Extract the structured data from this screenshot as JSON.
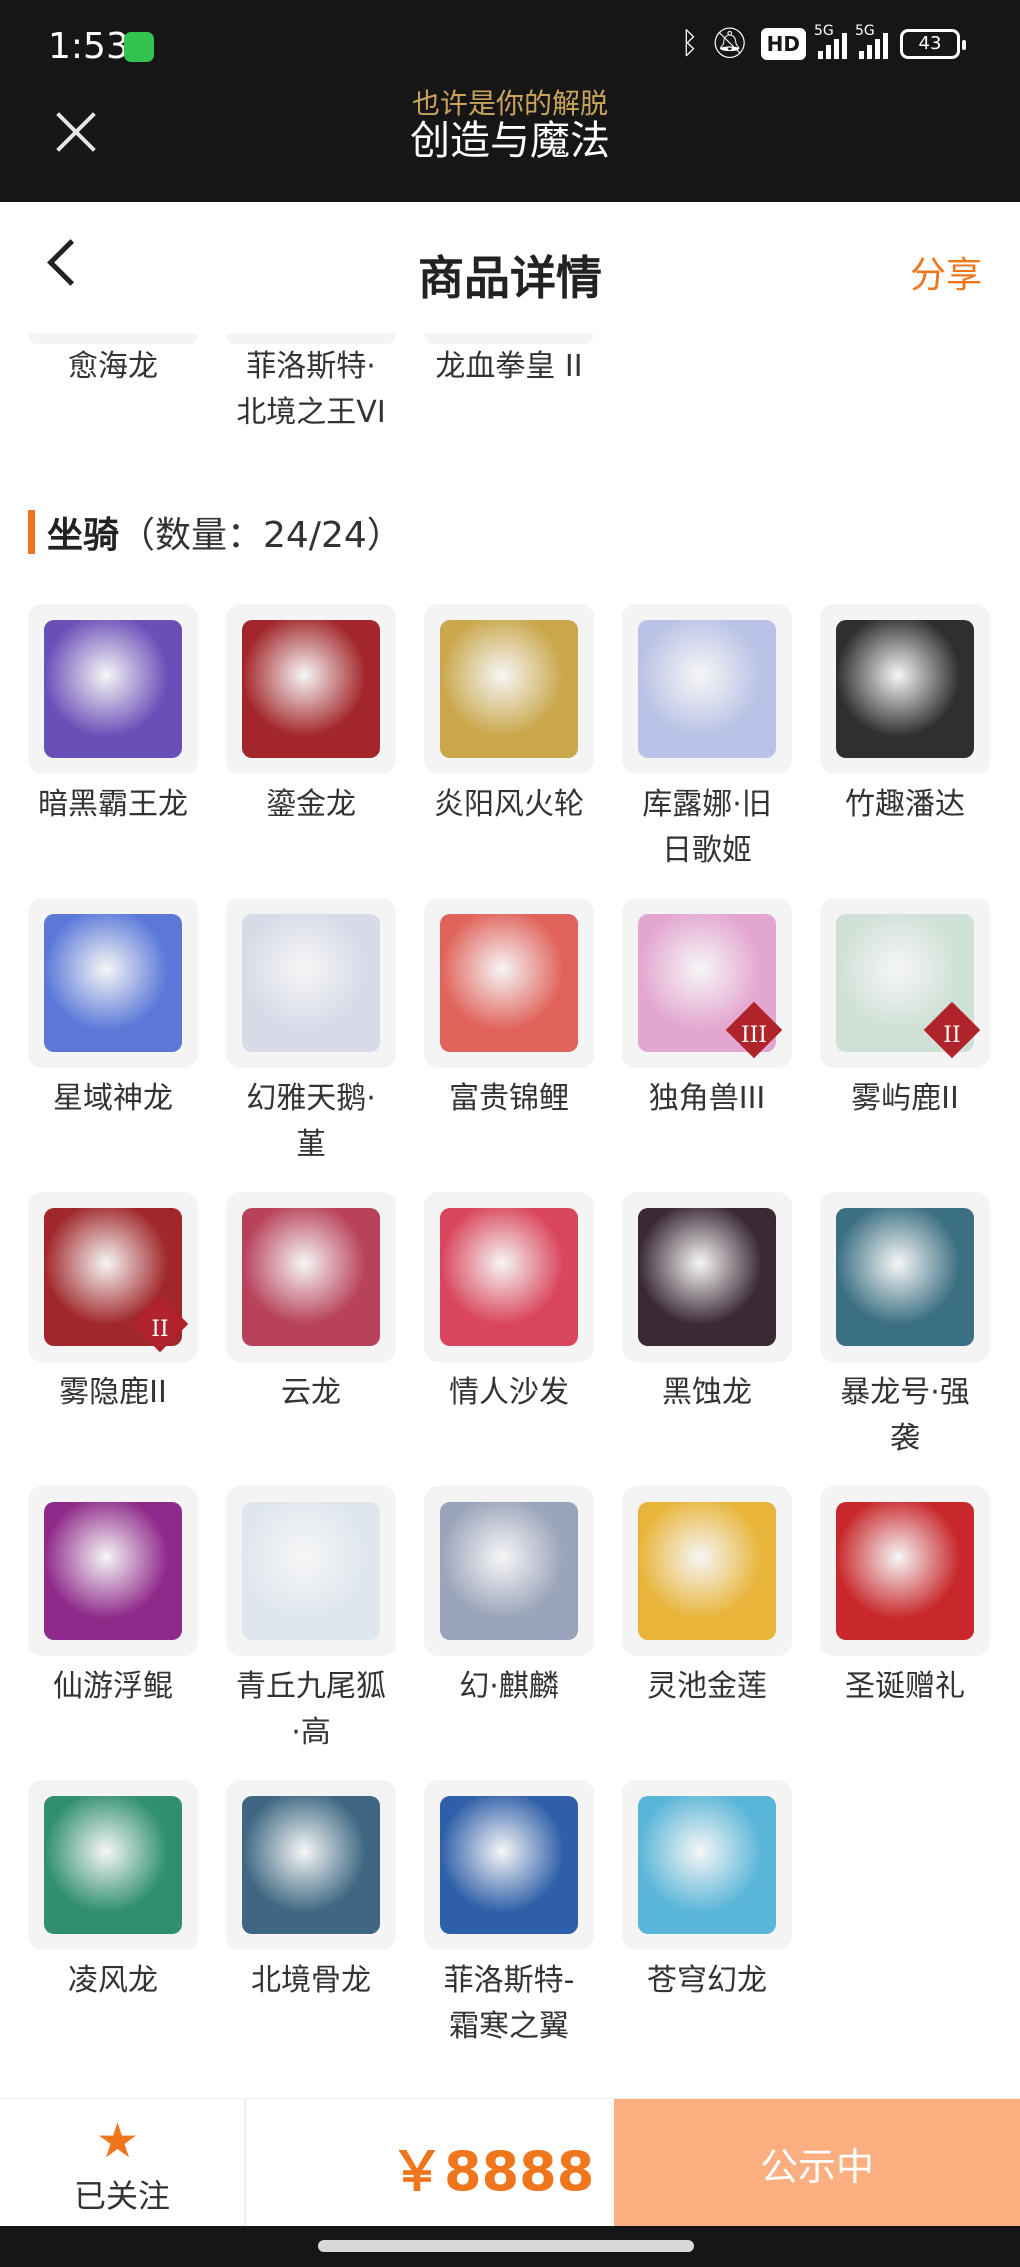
{
  "status_bar": {
    "time": "1:53",
    "bluetooth_icon": "bluetooth-icon",
    "mute_icon": "bell-off-icon",
    "hd_badge": "HD",
    "network_1": "5G",
    "network_2": "5G",
    "battery": "43"
  },
  "miniapp": {
    "subtitle": "也许是你的解脱",
    "title": "创造与魔法"
  },
  "nav": {
    "title": "商品详情",
    "share": "分享"
  },
  "prev_row": [
    "愈海龙",
    "菲洛斯特·北境之王VI",
    "龙血拳皇 II"
  ],
  "prev_row_lines": [
    [
      "愈海龙"
    ],
    [
      "菲洛斯特·",
      "北境之王VI"
    ],
    [
      "龙血拳皇 II"
    ]
  ],
  "mounts_section": {
    "name": "坐骑",
    "count": "（数量：24/24）"
  },
  "mounts": [
    {
      "name": "暗黑霸王龙",
      "lines": [
        "暗黑霸王龙"
      ],
      "color": "#6b4fb8"
    },
    {
      "name": "鎏金龙",
      "lines": [
        "鎏金龙"
      ],
      "color": "#a2262a"
    },
    {
      "name": "炎阳风火轮",
      "lines": [
        "炎阳风火轮"
      ],
      "color": "#c9a74a"
    },
    {
      "name": "库露娜·旧日歌姬",
      "lines": [
        "库露娜·旧",
        "日歌姬"
      ],
      "color": "#b9c2e6"
    },
    {
      "name": "竹趣潘达",
      "lines": [
        "竹趣潘达"
      ],
      "color": "#2f2f2f"
    },
    {
      "name": "星域神龙",
      "lines": [
        "星域神龙"
      ],
      "color": "#5a78d8"
    },
    {
      "name": "幻雅天鹅·堇",
      "lines": [
        "幻雅天鹅·",
        "堇"
      ],
      "color": "#d7dbe8"
    },
    {
      "name": "富贵锦鲤",
      "lines": [
        "富贵锦鲤"
      ],
      "color": "#e0625a"
    },
    {
      "name": "独角兽III",
      "lines": [
        "独角兽III"
      ],
      "color": "#e3a6d0",
      "emblem": "III"
    },
    {
      "name": "雾屿鹿II",
      "lines": [
        "雾屿鹿II"
      ],
      "color": "#cfe0d6",
      "emblem": "II"
    },
    {
      "name": "雾隐鹿II",
      "lines": [
        "雾隐鹿II"
      ],
      "color": "#a0282b",
      "emblem": "II"
    },
    {
      "name": "云龙",
      "lines": [
        "云龙"
      ],
      "color": "#b8425a"
    },
    {
      "name": "情人沙发",
      "lines": [
        "情人沙发"
      ],
      "color": "#d9455a"
    },
    {
      "name": "黑蚀龙",
      "lines": [
        "黑蚀龙"
      ],
      "color": "#3b2a36"
    },
    {
      "name": "暴龙号·强袭",
      "lines": [
        "暴龙号·强",
        "袭"
      ],
      "color": "#3b6f82"
    },
    {
      "name": "仙游浮鲲",
      "lines": [
        "仙游浮鲲"
      ],
      "color": "#8e2a8a"
    },
    {
      "name": "青丘九尾狐·高",
      "lines": [
        "青丘九尾狐",
        "·高"
      ],
      "color": "#dfe7ee"
    },
    {
      "name": "幻·麒麟",
      "lines": [
        "幻·麒麟"
      ],
      "color": "#9aa4ba"
    },
    {
      "name": "灵池金莲",
      "lines": [
        "灵池金莲"
      ],
      "color": "#e8b53a"
    },
    {
      "name": "圣诞赠礼",
      "lines": [
        "圣诞赠礼"
      ],
      "color": "#c8282c"
    },
    {
      "name": "凌风龙",
      "lines": [
        "凌风龙"
      ],
      "color": "#2f8f6f"
    },
    {
      "name": "北境骨龙",
      "lines": [
        "北境骨龙"
      ],
      "color": "#3d6782"
    },
    {
      "name": "菲洛斯特-霜寒之翼",
      "lines": [
        "菲洛斯特-",
        "霜寒之翼"
      ],
      "color": "#2f5fa8"
    },
    {
      "name": "苍穹幻龙",
      "lines": [
        "苍穹幻龙"
      ],
      "color": "#5ab6d8"
    }
  ],
  "bottom_bar": {
    "follow_icon": "star-icon",
    "follow_label": "已关注",
    "price": "￥8888",
    "status": "公示中"
  }
}
